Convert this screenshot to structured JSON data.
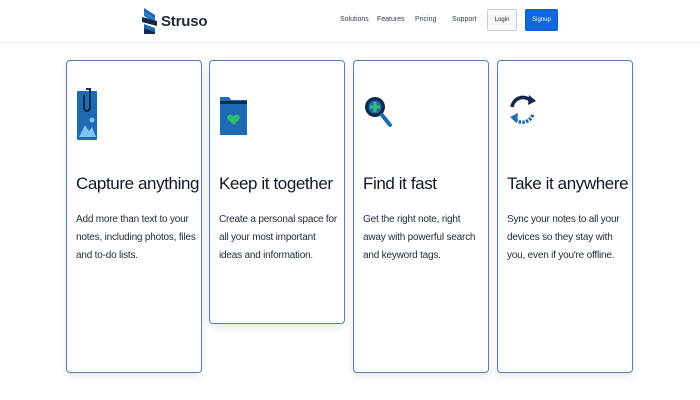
{
  "header": {
    "brand": "Struso",
    "nav": [
      "Solutions",
      "Features",
      "Pricing",
      "Support"
    ],
    "login_label": "Login",
    "signup_label": "Signup"
  },
  "colors": {
    "accent": "#1066de",
    "icon_blue": "#1f6bb3",
    "icon_green": "#2fbf71",
    "card_border": "#5b7fa6"
  },
  "cards": [
    {
      "icon": "image-clip-icon",
      "title": "Capture anything",
      "description": "Add more than text to your notes, including photos, files and to-do lists."
    },
    {
      "icon": "folder-heart-icon",
      "title": "Keep it together",
      "description": "Create a personal space for all your most important ideas and information."
    },
    {
      "icon": "search-plus-icon",
      "title": "Find it fast",
      "description": "Get the right note, right away with powerful search and keyword tags."
    },
    {
      "icon": "sync-icon",
      "title": "Take it anywhere",
      "description": "Sync your notes to all your devices so they stay with you, even if you're offline."
    }
  ]
}
